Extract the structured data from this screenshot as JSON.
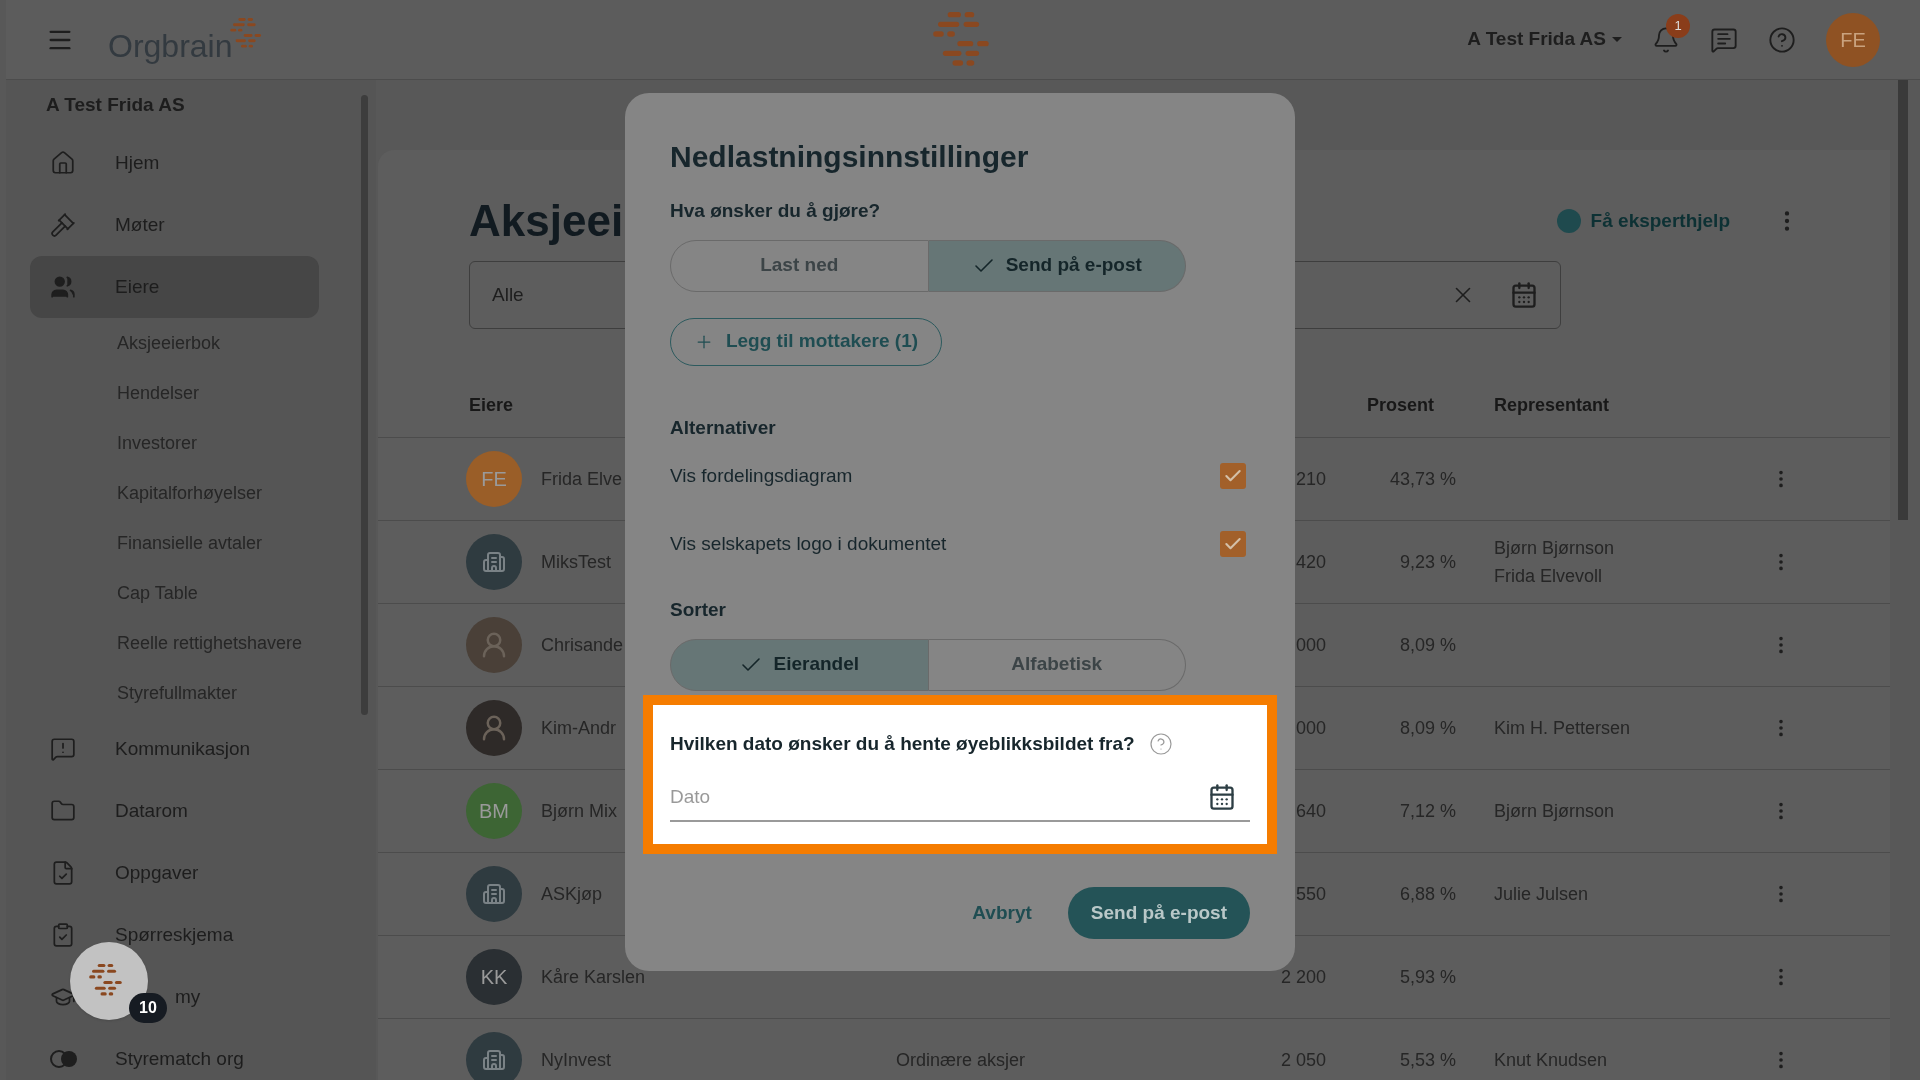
{
  "topbar": {
    "logo_text": "Orgbrain",
    "company_menu": "A Test Frida AS",
    "notifications_badge": "1",
    "avatar_initials": "FE"
  },
  "sidebar": {
    "company": "A Test Frida AS",
    "items": [
      {
        "label": "Hjem",
        "selected": false
      },
      {
        "label": "Møter",
        "selected": false
      },
      {
        "label": "Eiere",
        "selected": true,
        "children": [
          {
            "label": "Aksjeeierbok",
            "selected": false
          },
          {
            "label": "Hendelser",
            "selected": false
          },
          {
            "label": "Investorer",
            "selected": false
          },
          {
            "label": "Kapitalforhøyelser",
            "selected": false
          },
          {
            "label": "Finansielle avtaler",
            "selected": false
          },
          {
            "label": "Cap Table",
            "selected": false
          },
          {
            "label": "Reelle rettighetshavere",
            "selected": false
          },
          {
            "label": "Styrefullmakter",
            "selected": false
          }
        ]
      },
      {
        "label": "Kommunikasjon",
        "selected": false
      },
      {
        "label": "Datarom",
        "selected": false
      },
      {
        "label": "Oppgaver",
        "selected": false
      },
      {
        "label": "Spørreskjema",
        "selected": false
      },
      {
        "label": "my",
        "selected": false
      },
      {
        "label": "Styrematch org",
        "selected": false
      }
    ]
  },
  "help_bubble": {
    "badge": "10"
  },
  "page": {
    "title": "Aksjeei",
    "filter": {
      "value": "Alle"
    },
    "expert_help": "Få eksperthjelp",
    "table": {
      "columns": [
        "Eiere",
        "Prosent",
        "Representant"
      ],
      "rows": [
        {
          "avatar": {
            "kind": "initials",
            "text": "FE",
            "color": "#9a5e28"
          },
          "name": "Frida Elve",
          "column_3": "210",
          "percent": "43,73 %",
          "representatives": []
        },
        {
          "avatar": {
            "kind": "company",
            "color": "#2f3b40"
          },
          "name": "MiksTest",
          "column_3": "420",
          "percent": "9,23 %",
          "representatives": [
            "Bjørn Bjørnson",
            "Frida Elvevoll"
          ]
        },
        {
          "avatar": {
            "kind": "photo",
            "color": "#4a4038"
          },
          "name": "Chrisande",
          "column_3": "000",
          "percent": "8,09 %",
          "representatives": []
        },
        {
          "avatar": {
            "kind": "photo",
            "color": "#2e2a28"
          },
          "name": "Kim-Andr",
          "column_3": "000",
          "percent": "8,09 %",
          "representatives": [
            "Kim H. Pettersen"
          ]
        },
        {
          "avatar": {
            "kind": "initials",
            "text": "BM",
            "color": "#3d6534"
          },
          "name": "Bjørn Mix",
          "column_3": "640",
          "percent": "7,12 %",
          "representatives": [
            "Bjørn Bjørnson"
          ]
        },
        {
          "avatar": {
            "kind": "company",
            "color": "#2f3b40"
          },
          "name": "ASKjøp",
          "column_3": "550",
          "percent": "6,88 %",
          "representatives": [
            "Julie Julsen"
          ]
        },
        {
          "avatar": {
            "kind": "initials",
            "text": "KK",
            "color": "#2a2f33"
          },
          "name": "Kåre Karslen",
          "column_3": "2 200",
          "percent": "5,93 %",
          "representatives": []
        },
        {
          "avatar": {
            "kind": "company",
            "color": "#2f3b40"
          },
          "name": "NyInvest",
          "column_2": "Ordinære aksjer",
          "column_3": "2 050",
          "percent": "5,53 %",
          "representatives": [
            "Knut Knudsen"
          ]
        }
      ]
    }
  },
  "dialog": {
    "title": "Nedlastningsinnstillinger",
    "action_label": "Hva ønsker du å gjøre?",
    "actions": [
      {
        "label": "Last ned",
        "selected": false
      },
      {
        "label": "Send på e-post",
        "selected": true
      }
    ],
    "add_recipients": "Legg til mottakere (1)",
    "options_heading": "Alternativer",
    "options": [
      {
        "label": "Vis fordelingsdiagram",
        "checked": true
      },
      {
        "label": "Vis selskapets logo i dokumentet",
        "checked": true
      }
    ],
    "sort_heading": "Sorter",
    "sort_options": [
      {
        "label": "Eierandel",
        "selected": true
      },
      {
        "label": "Alfabetisk",
        "selected": false
      }
    ],
    "date_section": {
      "highlighted": true,
      "question": "Hvilken dato ønsker du å hente øyeblikksbildet fra?",
      "field": {
        "placeholder": "Dato"
      }
    },
    "buttons": {
      "cancel": "Avbryt",
      "submit": "Send på e-post"
    }
  }
}
